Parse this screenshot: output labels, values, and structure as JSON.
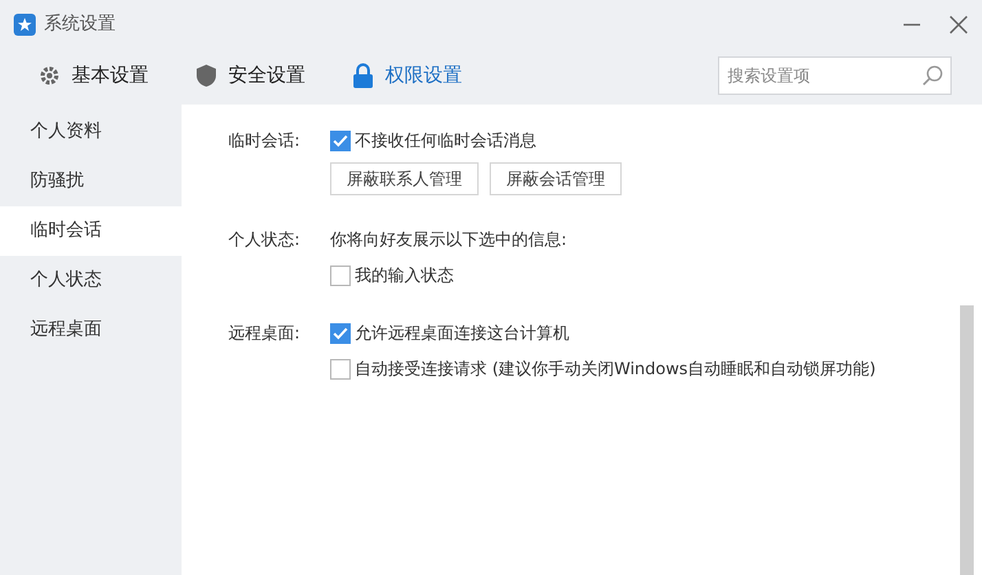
{
  "window": {
    "title": "系统设置"
  },
  "tabs": [
    {
      "label": "基本设置",
      "selected": false,
      "kind": "gear"
    },
    {
      "label": "安全设置",
      "selected": false,
      "kind": "shield"
    },
    {
      "label": "权限设置",
      "selected": true,
      "kind": "lock"
    }
  ],
  "search": {
    "placeholder": "搜索设置项"
  },
  "sidebar": {
    "items": [
      {
        "label": "个人资料",
        "selected": false
      },
      {
        "label": "防骚扰",
        "selected": false
      },
      {
        "label": "临时会话",
        "selected": true
      },
      {
        "label": "个人状态",
        "selected": false
      },
      {
        "label": "远程桌面",
        "selected": false
      }
    ]
  },
  "sections": [
    {
      "label": "临时会话:",
      "rows": [
        {
          "kind": "checkbox",
          "text": "不接收任何临时会话消息",
          "checked": true
        },
        {
          "kind": "buttons",
          "buttons": [
            "屏蔽联系人管理",
            "屏蔽会话管理"
          ]
        }
      ]
    },
    {
      "label": "个人状态:",
      "rows": [
        {
          "kind": "text",
          "text": "你将向好友展示以下选中的信息:"
        },
        {
          "kind": "checkbox",
          "text": "我的输入状态",
          "checked": false
        }
      ]
    },
    {
      "label": "远程桌面:",
      "rows": [
        {
          "kind": "checkbox",
          "text": "允许远程桌面连接这台计算机",
          "checked": true
        },
        {
          "kind": "checkbox",
          "text": "自动接受连接请求 (建议你手动关闭Windows自动睡眠和自动锁屏功能)",
          "checked": false
        }
      ]
    }
  ]
}
